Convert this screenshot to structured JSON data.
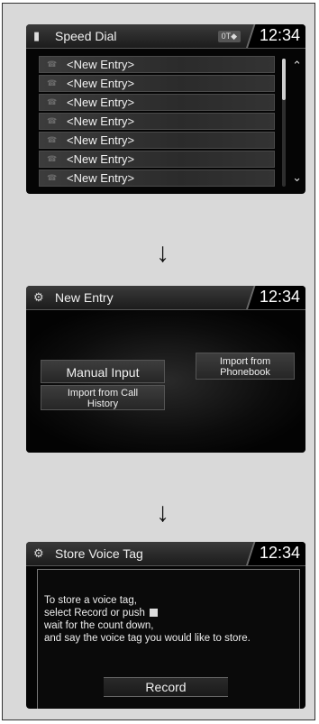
{
  "screen1": {
    "title": "Speed Dial",
    "status_badge": "0T◆",
    "clock": "12:34",
    "entries": [
      "<New Entry>",
      "<New Entry>",
      "<New Entry>",
      "<New Entry>",
      "<New Entry>",
      "<New Entry>",
      "<New Entry>"
    ]
  },
  "screen2": {
    "title": "New Entry",
    "clock": "12:34",
    "options": {
      "manual_input": "Manual Input",
      "import_phonebook_line1": "Import from",
      "import_phonebook_line2": "Phonebook",
      "import_call_history_line1": "Import from Call",
      "import_call_history_line2": "History"
    }
  },
  "screen3": {
    "title": "Store Voice Tag",
    "clock": "12:34",
    "message_line1": "To store a voice tag,",
    "message_line2a": "select Record or push",
    "message_line3": "wait for the count down,",
    "message_line4": "and say the voice tag you would like to store.",
    "record_label": "Record"
  },
  "arrows": {
    "down": "↓"
  }
}
